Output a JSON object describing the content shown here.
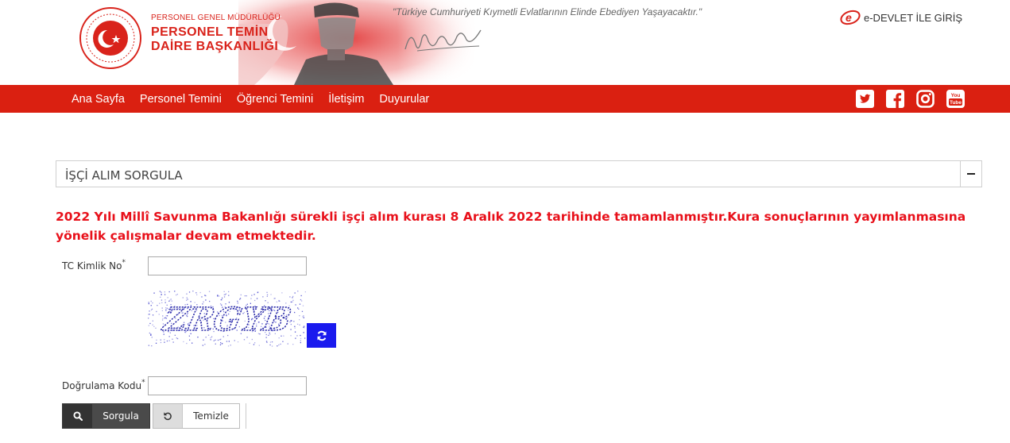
{
  "header": {
    "org_subtitle": "PERSONEL GENEL MÜDÜRLÜĞÜ",
    "org_title_line1": "PERSONEL TEMİN",
    "org_title_line2": "DAİRE BAŞKANLIĞI",
    "quote": "\"Türkiye Cumhuriyeti Kıymetli Evlatlarının Elinde Ebediyen Yaşayacaktır.\"",
    "edevlet_label": "e-DEVLET İLE GİRİŞ"
  },
  "nav": {
    "items": [
      {
        "label": "Ana Sayfa"
      },
      {
        "label": "Personel Temini"
      },
      {
        "label": "Öğrenci Temini"
      },
      {
        "label": "İletişim"
      },
      {
        "label": "Duyurular"
      }
    ],
    "social": [
      "twitter-icon",
      "facebook-icon",
      "instagram-icon",
      "youtube-icon"
    ]
  },
  "panel": {
    "title": "İŞÇİ ALIM SORGULA"
  },
  "notice": {
    "text": "2022 Yılı Millî Savunma Bakanlığı sürekli işçi alım kurası 8 Aralık 2022 tarihinde tamamlanmıştır.Kura sonuçlarının yayımlanmasına yönelik çalışmalar devam etmektedir."
  },
  "form": {
    "tc_label": "TC Kimlik No",
    "tc_value": "",
    "required_mark": "*",
    "captcha_text": "ZRGYB",
    "verify_label": "Doğrulama Kodu",
    "verify_value": "",
    "search_button": "Sorgula",
    "clear_button": "Temizle"
  },
  "colors": {
    "brand_red": "#da2011",
    "notice_red": "#e8101a",
    "refresh_blue": "#1a1aee"
  }
}
